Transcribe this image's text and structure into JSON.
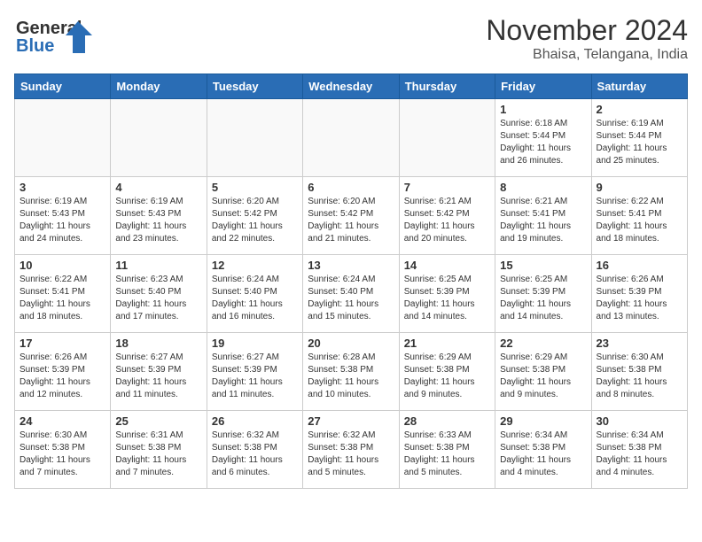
{
  "header": {
    "logo_general": "General",
    "logo_blue": "Blue",
    "month": "November 2024",
    "location": "Bhaisa, Telangana, India"
  },
  "days_of_week": [
    "Sunday",
    "Monday",
    "Tuesday",
    "Wednesday",
    "Thursday",
    "Friday",
    "Saturday"
  ],
  "weeks": [
    [
      {
        "day": "",
        "info": ""
      },
      {
        "day": "",
        "info": ""
      },
      {
        "day": "",
        "info": ""
      },
      {
        "day": "",
        "info": ""
      },
      {
        "day": "",
        "info": ""
      },
      {
        "day": "1",
        "info": "Sunrise: 6:18 AM\nSunset: 5:44 PM\nDaylight: 11 hours and 26 minutes."
      },
      {
        "day": "2",
        "info": "Sunrise: 6:19 AM\nSunset: 5:44 PM\nDaylight: 11 hours and 25 minutes."
      }
    ],
    [
      {
        "day": "3",
        "info": "Sunrise: 6:19 AM\nSunset: 5:43 PM\nDaylight: 11 hours and 24 minutes."
      },
      {
        "day": "4",
        "info": "Sunrise: 6:19 AM\nSunset: 5:43 PM\nDaylight: 11 hours and 23 minutes."
      },
      {
        "day": "5",
        "info": "Sunrise: 6:20 AM\nSunset: 5:42 PM\nDaylight: 11 hours and 22 minutes."
      },
      {
        "day": "6",
        "info": "Sunrise: 6:20 AM\nSunset: 5:42 PM\nDaylight: 11 hours and 21 minutes."
      },
      {
        "day": "7",
        "info": "Sunrise: 6:21 AM\nSunset: 5:42 PM\nDaylight: 11 hours and 20 minutes."
      },
      {
        "day": "8",
        "info": "Sunrise: 6:21 AM\nSunset: 5:41 PM\nDaylight: 11 hours and 19 minutes."
      },
      {
        "day": "9",
        "info": "Sunrise: 6:22 AM\nSunset: 5:41 PM\nDaylight: 11 hours and 18 minutes."
      }
    ],
    [
      {
        "day": "10",
        "info": "Sunrise: 6:22 AM\nSunset: 5:41 PM\nDaylight: 11 hours and 18 minutes."
      },
      {
        "day": "11",
        "info": "Sunrise: 6:23 AM\nSunset: 5:40 PM\nDaylight: 11 hours and 17 minutes."
      },
      {
        "day": "12",
        "info": "Sunrise: 6:24 AM\nSunset: 5:40 PM\nDaylight: 11 hours and 16 minutes."
      },
      {
        "day": "13",
        "info": "Sunrise: 6:24 AM\nSunset: 5:40 PM\nDaylight: 11 hours and 15 minutes."
      },
      {
        "day": "14",
        "info": "Sunrise: 6:25 AM\nSunset: 5:39 PM\nDaylight: 11 hours and 14 minutes."
      },
      {
        "day": "15",
        "info": "Sunrise: 6:25 AM\nSunset: 5:39 PM\nDaylight: 11 hours and 14 minutes."
      },
      {
        "day": "16",
        "info": "Sunrise: 6:26 AM\nSunset: 5:39 PM\nDaylight: 11 hours and 13 minutes."
      }
    ],
    [
      {
        "day": "17",
        "info": "Sunrise: 6:26 AM\nSunset: 5:39 PM\nDaylight: 11 hours and 12 minutes."
      },
      {
        "day": "18",
        "info": "Sunrise: 6:27 AM\nSunset: 5:39 PM\nDaylight: 11 hours and 11 minutes."
      },
      {
        "day": "19",
        "info": "Sunrise: 6:27 AM\nSunset: 5:39 PM\nDaylight: 11 hours and 11 minutes."
      },
      {
        "day": "20",
        "info": "Sunrise: 6:28 AM\nSunset: 5:38 PM\nDaylight: 11 hours and 10 minutes."
      },
      {
        "day": "21",
        "info": "Sunrise: 6:29 AM\nSunset: 5:38 PM\nDaylight: 11 hours and 9 minutes."
      },
      {
        "day": "22",
        "info": "Sunrise: 6:29 AM\nSunset: 5:38 PM\nDaylight: 11 hours and 9 minutes."
      },
      {
        "day": "23",
        "info": "Sunrise: 6:30 AM\nSunset: 5:38 PM\nDaylight: 11 hours and 8 minutes."
      }
    ],
    [
      {
        "day": "24",
        "info": "Sunrise: 6:30 AM\nSunset: 5:38 PM\nDaylight: 11 hours and 7 minutes."
      },
      {
        "day": "25",
        "info": "Sunrise: 6:31 AM\nSunset: 5:38 PM\nDaylight: 11 hours and 7 minutes."
      },
      {
        "day": "26",
        "info": "Sunrise: 6:32 AM\nSunset: 5:38 PM\nDaylight: 11 hours and 6 minutes."
      },
      {
        "day": "27",
        "info": "Sunrise: 6:32 AM\nSunset: 5:38 PM\nDaylight: 11 hours and 5 minutes."
      },
      {
        "day": "28",
        "info": "Sunrise: 6:33 AM\nSunset: 5:38 PM\nDaylight: 11 hours and 5 minutes."
      },
      {
        "day": "29",
        "info": "Sunrise: 6:34 AM\nSunset: 5:38 PM\nDaylight: 11 hours and 4 minutes."
      },
      {
        "day": "30",
        "info": "Sunrise: 6:34 AM\nSunset: 5:38 PM\nDaylight: 11 hours and 4 minutes."
      }
    ]
  ]
}
